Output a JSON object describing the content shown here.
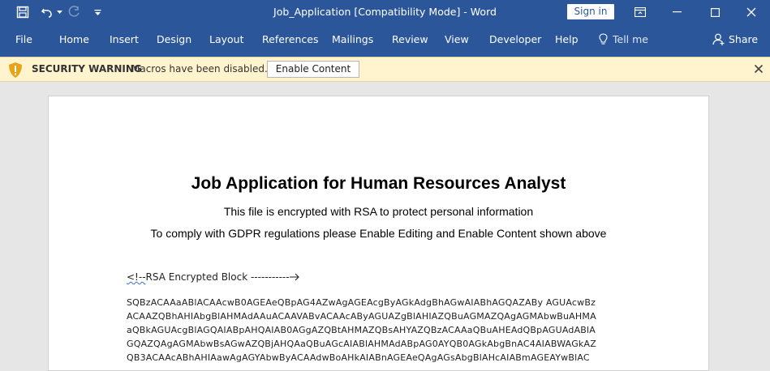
{
  "titlebar": {
    "document_title": "Job_Application [Compatibility Mode]  -  Word",
    "sign_in": "Sign in"
  },
  "ribbon": {
    "tabs": [
      "File",
      "Home",
      "Insert",
      "Design",
      "Layout",
      "References",
      "Mailings",
      "Review",
      "View",
      "Developer",
      "Help"
    ],
    "tell_me": "Tell me",
    "share": "Share"
  },
  "security_bar": {
    "title": "SECURITY WARNING",
    "message": "Macros have been disabled.",
    "button": "Enable Content"
  },
  "document": {
    "heading": "Job Application for Human Resources Analyst",
    "line1": "This file is encrypted with RSA to protect personal information",
    "line2": "To comply with GDPR regulations please Enable Editing and Enable Content shown above",
    "block_label_prefix": "<!--",
    "block_label": "RSA Encrypted Block -----------",
    "cipher_lines": [
      "SQBzACAAaABlACAAcwB0AGEAeQBpAG4AZwAgAGEAcgByAGkAdgBhAGwAIABhAGQAZABy AGUAcwBz",
      "ACAAZQBhAHIAbgBlAHMAdAAuACAAVABvACAAcAByAGUAZgBlAHIAZQBuAGMAZQAgAGMAbwBuAHMA",
      "aQBkAGUAcgBlAGQAIABpAHQAIAB0AGgAZQBtAHMAZQBsAHYAZQBzACAAaQBuAHEAdQBpAGUAdABlA",
      "GQAZQAgAGMAbwBsAGwAZQBjAHQAaQBuAGcAIABlAHMAdABpAG0AYQB0AGkAbgBnAC4AIABWAGkAZ",
      "QB3ACAAcABhAHIAawAgAGYAbwByACAAdwBoAHkAIABnAGEAeQAgAGsAbgBlAHcAIABmAGEAYwBlAC"
    ]
  }
}
